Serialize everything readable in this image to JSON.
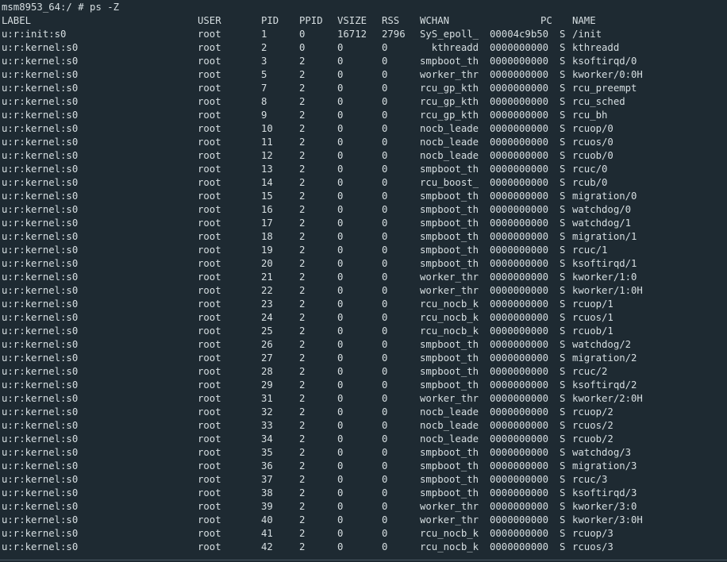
{
  "prompt": "msm8953_64:/ # ps -Z",
  "header": {
    "label": "LABEL",
    "user": "USER",
    "pid": "PID",
    "ppid": "PPID",
    "vsize": "VSIZE",
    "rss": "RSS",
    "wchan": "WCHAN",
    "pc": "PC",
    "name": "NAME"
  },
  "rows": [
    {
      "label": "u:r:init:s0",
      "user": "root",
      "pid": "1",
      "ppid": "0",
      "vsize": "16712",
      "rss": "2796",
      "wchan": "SyS_epoll_",
      "pc": "00004c9b50",
      "state": "S",
      "name": "/init"
    },
    {
      "label": "u:r:kernel:s0",
      "user": "root",
      "pid": "2",
      "ppid": "0",
      "vsize": "0",
      "rss": "0",
      "wchan": "  kthreadd",
      "pc": "0000000000",
      "state": "S",
      "name": "kthreadd"
    },
    {
      "label": "u:r:kernel:s0",
      "user": "root",
      "pid": "3",
      "ppid": "2",
      "vsize": "0",
      "rss": "0",
      "wchan": "smpboot_th",
      "pc": "0000000000",
      "state": "S",
      "name": "ksoftirqd/0"
    },
    {
      "label": "u:r:kernel:s0",
      "user": "root",
      "pid": "5",
      "ppid": "2",
      "vsize": "0",
      "rss": "0",
      "wchan": "worker_thr",
      "pc": "0000000000",
      "state": "S",
      "name": "kworker/0:0H"
    },
    {
      "label": "u:r:kernel:s0",
      "user": "root",
      "pid": "7",
      "ppid": "2",
      "vsize": "0",
      "rss": "0",
      "wchan": "rcu_gp_kth",
      "pc": "0000000000",
      "state": "S",
      "name": "rcu_preempt"
    },
    {
      "label": "u:r:kernel:s0",
      "user": "root",
      "pid": "8",
      "ppid": "2",
      "vsize": "0",
      "rss": "0",
      "wchan": "rcu_gp_kth",
      "pc": "0000000000",
      "state": "S",
      "name": "rcu_sched"
    },
    {
      "label": "u:r:kernel:s0",
      "user": "root",
      "pid": "9",
      "ppid": "2",
      "vsize": "0",
      "rss": "0",
      "wchan": "rcu_gp_kth",
      "pc": "0000000000",
      "state": "S",
      "name": "rcu_bh"
    },
    {
      "label": "u:r:kernel:s0",
      "user": "root",
      "pid": "10",
      "ppid": "2",
      "vsize": "0",
      "rss": "0",
      "wchan": "nocb_leade",
      "pc": "0000000000",
      "state": "S",
      "name": "rcuop/0"
    },
    {
      "label": "u:r:kernel:s0",
      "user": "root",
      "pid": "11",
      "ppid": "2",
      "vsize": "0",
      "rss": "0",
      "wchan": "nocb_leade",
      "pc": "0000000000",
      "state": "S",
      "name": "rcuos/0"
    },
    {
      "label": "u:r:kernel:s0",
      "user": "root",
      "pid": "12",
      "ppid": "2",
      "vsize": "0",
      "rss": "0",
      "wchan": "nocb_leade",
      "pc": "0000000000",
      "state": "S",
      "name": "rcuob/0"
    },
    {
      "label": "u:r:kernel:s0",
      "user": "root",
      "pid": "13",
      "ppid": "2",
      "vsize": "0",
      "rss": "0",
      "wchan": "smpboot_th",
      "pc": "0000000000",
      "state": "S",
      "name": "rcuc/0"
    },
    {
      "label": "u:r:kernel:s0",
      "user": "root",
      "pid": "14",
      "ppid": "2",
      "vsize": "0",
      "rss": "0",
      "wchan": "rcu_boost_",
      "pc": "0000000000",
      "state": "S",
      "name": "rcub/0"
    },
    {
      "label": "u:r:kernel:s0",
      "user": "root",
      "pid": "15",
      "ppid": "2",
      "vsize": "0",
      "rss": "0",
      "wchan": "smpboot_th",
      "pc": "0000000000",
      "state": "S",
      "name": "migration/0"
    },
    {
      "label": "u:r:kernel:s0",
      "user": "root",
      "pid": "16",
      "ppid": "2",
      "vsize": "0",
      "rss": "0",
      "wchan": "smpboot_th",
      "pc": "0000000000",
      "state": "S",
      "name": "watchdog/0"
    },
    {
      "label": "u:r:kernel:s0",
      "user": "root",
      "pid": "17",
      "ppid": "2",
      "vsize": "0",
      "rss": "0",
      "wchan": "smpboot_th",
      "pc": "0000000000",
      "state": "S",
      "name": "watchdog/1"
    },
    {
      "label": "u:r:kernel:s0",
      "user": "root",
      "pid": "18",
      "ppid": "2",
      "vsize": "0",
      "rss": "0",
      "wchan": "smpboot_th",
      "pc": "0000000000",
      "state": "S",
      "name": "migration/1"
    },
    {
      "label": "u:r:kernel:s0",
      "user": "root",
      "pid": "19",
      "ppid": "2",
      "vsize": "0",
      "rss": "0",
      "wchan": "smpboot_th",
      "pc": "0000000000",
      "state": "S",
      "name": "rcuc/1"
    },
    {
      "label": "u:r:kernel:s0",
      "user": "root",
      "pid": "20",
      "ppid": "2",
      "vsize": "0",
      "rss": "0",
      "wchan": "smpboot_th",
      "pc": "0000000000",
      "state": "S",
      "name": "ksoftirqd/1"
    },
    {
      "label": "u:r:kernel:s0",
      "user": "root",
      "pid": "21",
      "ppid": "2",
      "vsize": "0",
      "rss": "0",
      "wchan": "worker_thr",
      "pc": "0000000000",
      "state": "S",
      "name": "kworker/1:0"
    },
    {
      "label": "u:r:kernel:s0",
      "user": "root",
      "pid": "22",
      "ppid": "2",
      "vsize": "0",
      "rss": "0",
      "wchan": "worker_thr",
      "pc": "0000000000",
      "state": "S",
      "name": "kworker/1:0H"
    },
    {
      "label": "u:r:kernel:s0",
      "user": "root",
      "pid": "23",
      "ppid": "2",
      "vsize": "0",
      "rss": "0",
      "wchan": "rcu_nocb_k",
      "pc": "0000000000",
      "state": "S",
      "name": "rcuop/1"
    },
    {
      "label": "u:r:kernel:s0",
      "user": "root",
      "pid": "24",
      "ppid": "2",
      "vsize": "0",
      "rss": "0",
      "wchan": "rcu_nocb_k",
      "pc": "0000000000",
      "state": "S",
      "name": "rcuos/1"
    },
    {
      "label": "u:r:kernel:s0",
      "user": "root",
      "pid": "25",
      "ppid": "2",
      "vsize": "0",
      "rss": "0",
      "wchan": "rcu_nocb_k",
      "pc": "0000000000",
      "state": "S",
      "name": "rcuob/1"
    },
    {
      "label": "u:r:kernel:s0",
      "user": "root",
      "pid": "26",
      "ppid": "2",
      "vsize": "0",
      "rss": "0",
      "wchan": "smpboot_th",
      "pc": "0000000000",
      "state": "S",
      "name": "watchdog/2"
    },
    {
      "label": "u:r:kernel:s0",
      "user": "root",
      "pid": "27",
      "ppid": "2",
      "vsize": "0",
      "rss": "0",
      "wchan": "smpboot_th",
      "pc": "0000000000",
      "state": "S",
      "name": "migration/2"
    },
    {
      "label": "u:r:kernel:s0",
      "user": "root",
      "pid": "28",
      "ppid": "2",
      "vsize": "0",
      "rss": "0",
      "wchan": "smpboot_th",
      "pc": "0000000000",
      "state": "S",
      "name": "rcuc/2"
    },
    {
      "label": "u:r:kernel:s0",
      "user": "root",
      "pid": "29",
      "ppid": "2",
      "vsize": "0",
      "rss": "0",
      "wchan": "smpboot_th",
      "pc": "0000000000",
      "state": "S",
      "name": "ksoftirqd/2"
    },
    {
      "label": "u:r:kernel:s0",
      "user": "root",
      "pid": "31",
      "ppid": "2",
      "vsize": "0",
      "rss": "0",
      "wchan": "worker_thr",
      "pc": "0000000000",
      "state": "S",
      "name": "kworker/2:0H"
    },
    {
      "label": "u:r:kernel:s0",
      "user": "root",
      "pid": "32",
      "ppid": "2",
      "vsize": "0",
      "rss": "0",
      "wchan": "nocb_leade",
      "pc": "0000000000",
      "state": "S",
      "name": "rcuop/2"
    },
    {
      "label": "u:r:kernel:s0",
      "user": "root",
      "pid": "33",
      "ppid": "2",
      "vsize": "0",
      "rss": "0",
      "wchan": "nocb_leade",
      "pc": "0000000000",
      "state": "S",
      "name": "rcuos/2"
    },
    {
      "label": "u:r:kernel:s0",
      "user": "root",
      "pid": "34",
      "ppid": "2",
      "vsize": "0",
      "rss": "0",
      "wchan": "nocb_leade",
      "pc": "0000000000",
      "state": "S",
      "name": "rcuob/2"
    },
    {
      "label": "u:r:kernel:s0",
      "user": "root",
      "pid": "35",
      "ppid": "2",
      "vsize": "0",
      "rss": "0",
      "wchan": "smpboot_th",
      "pc": "0000000000",
      "state": "S",
      "name": "watchdog/3"
    },
    {
      "label": "u:r:kernel:s0",
      "user": "root",
      "pid": "36",
      "ppid": "2",
      "vsize": "0",
      "rss": "0",
      "wchan": "smpboot_th",
      "pc": "0000000000",
      "state": "S",
      "name": "migration/3"
    },
    {
      "label": "u:r:kernel:s0",
      "user": "root",
      "pid": "37",
      "ppid": "2",
      "vsize": "0",
      "rss": "0",
      "wchan": "smpboot_th",
      "pc": "0000000000",
      "state": "S",
      "name": "rcuc/3"
    },
    {
      "label": "u:r:kernel:s0",
      "user": "root",
      "pid": "38",
      "ppid": "2",
      "vsize": "0",
      "rss": "0",
      "wchan": "smpboot_th",
      "pc": "0000000000",
      "state": "S",
      "name": "ksoftirqd/3"
    },
    {
      "label": "u:r:kernel:s0",
      "user": "root",
      "pid": "39",
      "ppid": "2",
      "vsize": "0",
      "rss": "0",
      "wchan": "worker_thr",
      "pc": "0000000000",
      "state": "S",
      "name": "kworker/3:0"
    },
    {
      "label": "u:r:kernel:s0",
      "user": "root",
      "pid": "40",
      "ppid": "2",
      "vsize": "0",
      "rss": "0",
      "wchan": "worker_thr",
      "pc": "0000000000",
      "state": "S",
      "name": "kworker/3:0H"
    },
    {
      "label": "u:r:kernel:s0",
      "user": "root",
      "pid": "41",
      "ppid": "2",
      "vsize": "0",
      "rss": "0",
      "wchan": "rcu_nocb_k",
      "pc": "0000000000",
      "state": "S",
      "name": "rcuop/3"
    },
    {
      "label": "u:r:kernel:s0",
      "user": "root",
      "pid": "42",
      "ppid": "2",
      "vsize": "0",
      "rss": "0",
      "wchan": "rcu_nocb_k",
      "pc": "0000000000",
      "state": "S",
      "name": "rcuos/3"
    }
  ],
  "colors": {
    "background": "#1e2a32",
    "foreground": "#d7dfe2"
  }
}
